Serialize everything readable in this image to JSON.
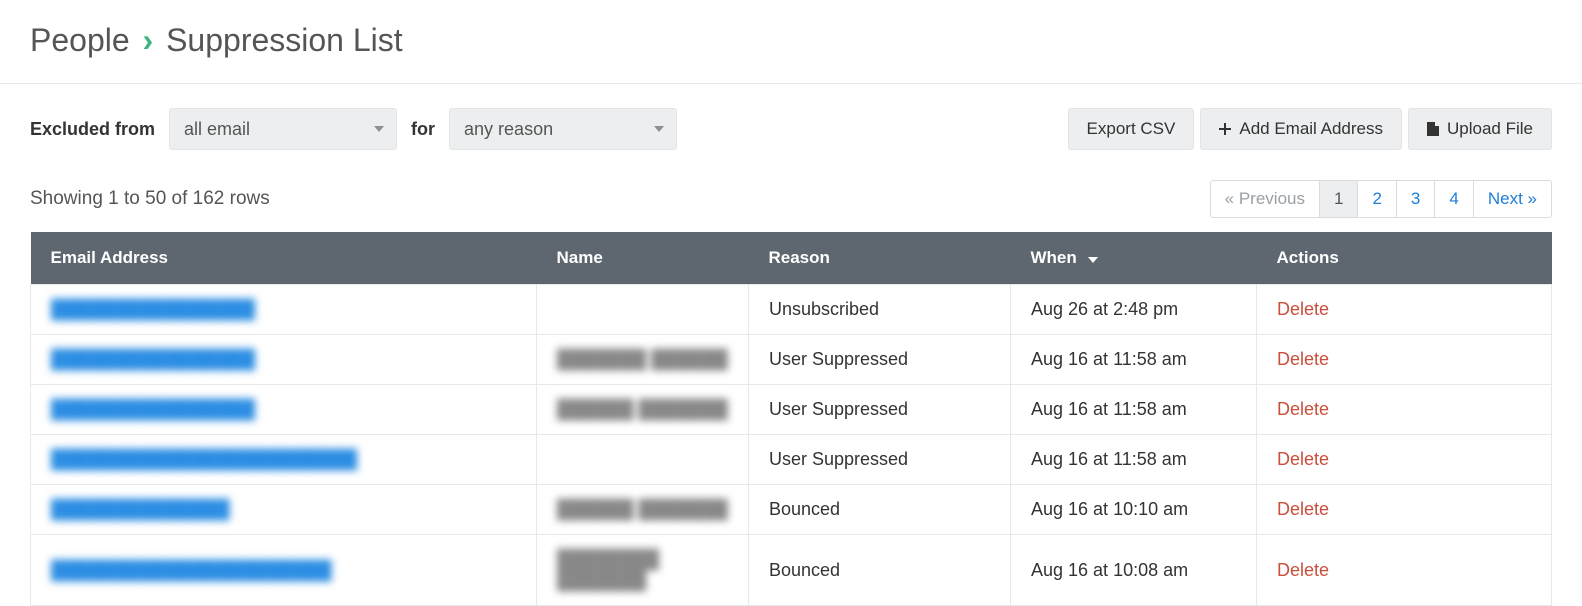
{
  "breadcrumb": {
    "root": "People",
    "separator": "›",
    "leaf": "Suppression List"
  },
  "filters": {
    "excluded_label": "Excluded from",
    "excluded_value": "all email",
    "for_label": "for",
    "reason_value": "any reason"
  },
  "buttons": {
    "export_csv": "Export CSV",
    "add_email": "Add Email Address",
    "upload_file": "Upload File"
  },
  "showing_text": "Showing 1 to 50 of 162 rows",
  "pagination": {
    "prev": "« Previous",
    "pages": [
      "1",
      "2",
      "3",
      "4"
    ],
    "active_index": 0,
    "next": "Next »"
  },
  "columns": {
    "email": "Email Address",
    "name": "Name",
    "reason": "Reason",
    "when": "When",
    "actions": "Actions"
  },
  "delete_label": "Delete",
  "rows": [
    {
      "email": "████████████████",
      "name": "",
      "reason": "Unsubscribed",
      "when": "Aug 26 at 2:48 pm"
    },
    {
      "email": "████████████████",
      "name": "███████ ██████",
      "reason": "User Suppressed",
      "when": "Aug 16 at 11:58 am"
    },
    {
      "email": "████████████████",
      "name": "██████ ███████",
      "reason": "User Suppressed",
      "when": "Aug 16 at 11:58 am"
    },
    {
      "email": "████████████████████████",
      "name": "",
      "reason": "User Suppressed",
      "when": "Aug 16 at 11:58 am"
    },
    {
      "email": "██████████████",
      "name": "██████ ███████",
      "reason": "Bounced",
      "when": "Aug 16 at 10:10 am"
    },
    {
      "email": "██████████████████████",
      "name": "████████ ███████",
      "reason": "Bounced",
      "when": "Aug 16 at 10:08 am"
    }
  ]
}
